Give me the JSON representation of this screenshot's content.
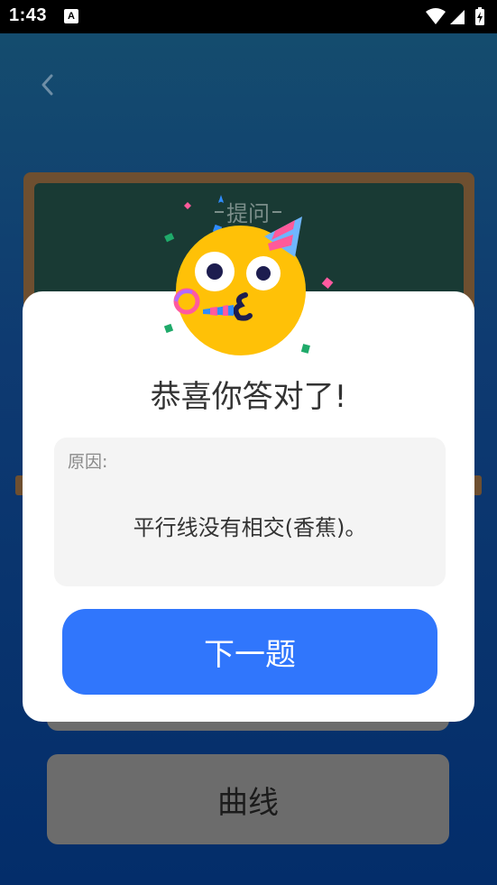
{
  "status_bar": {
    "time": "1:43",
    "notification_icon": "A",
    "icons": [
      "wifi-icon",
      "signal-icon",
      "battery-charging-icon"
    ]
  },
  "header": {
    "back_icon": "chevron-left-icon"
  },
  "board": {
    "title": "提问"
  },
  "modal": {
    "emoji_icon": "party-face-icon",
    "title": "恭喜你答对了!",
    "reason_label": "原因:",
    "reason_text": "平行线没有相交(香蕉)。",
    "next_button": "下一题"
  },
  "options": [
    {
      "label": "曲线"
    }
  ],
  "colors": {
    "primary": "#3076fc",
    "board": "#193a34",
    "board_frame": "#6e4f30",
    "option": "#6c6c6c"
  }
}
